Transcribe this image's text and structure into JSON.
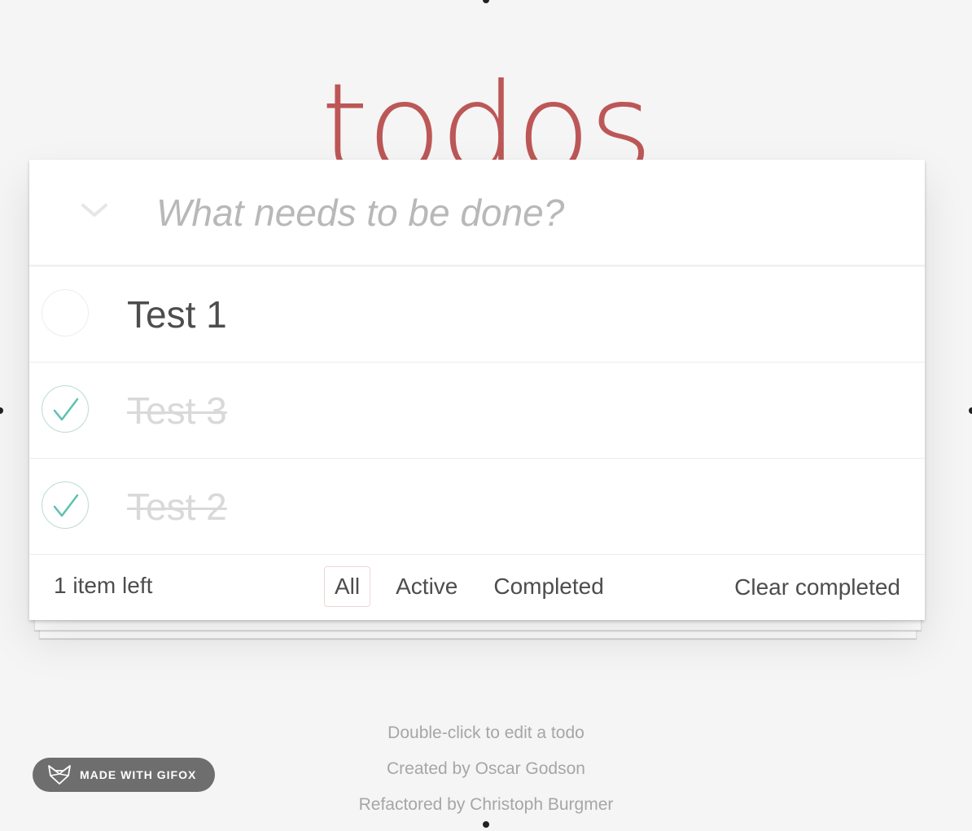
{
  "app_title": "todos",
  "new_todo": {
    "placeholder": "What needs to be done?",
    "value": ""
  },
  "todos": [
    {
      "label": "Test 1",
      "completed": false
    },
    {
      "label": "Test 3",
      "completed": true
    },
    {
      "label": "Test 2",
      "completed": true
    }
  ],
  "footer": {
    "count_text": "1 item left",
    "filters": [
      {
        "label": "All",
        "selected": true
      },
      {
        "label": "Active",
        "selected": false
      },
      {
        "label": "Completed",
        "selected": false
      }
    ],
    "clear_label": "Clear completed"
  },
  "info": {
    "line1": "Double-click to edit a todo",
    "line2": "Created by Oscar Godson",
    "line3": "Refactored by Christoph Burgmer"
  },
  "badge": {
    "label": "MADE WITH GIFOX",
    "icon": "fox-icon"
  },
  "colors": {
    "title": "#b83f45",
    "check": "#5dc2af",
    "selected_filter_border": "#efd5d5"
  }
}
